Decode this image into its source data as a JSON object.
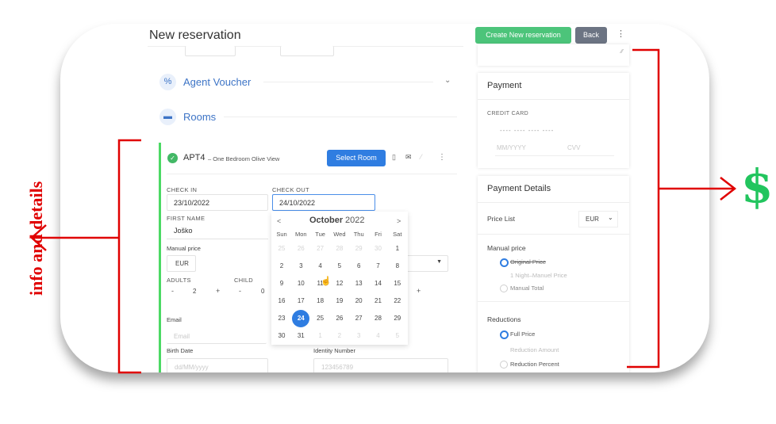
{
  "header": {
    "title": "New reservation",
    "create_button": "Create New reservation",
    "back_button": "Back",
    "more_icon": "kebab-icon"
  },
  "sections": {
    "agent_voucher": "Agent Voucher",
    "rooms": "Rooms"
  },
  "room": {
    "name": "APT4",
    "description": "– One Bedroom Olive View",
    "select_button": "Select Room"
  },
  "form": {
    "check_in_label": "CHECK IN",
    "check_in_value": "23/10/2022",
    "check_out_label": "CHECK OUT",
    "check_out_value": "24/10/2022",
    "first_name_label": "FIRST NAME",
    "first_name_value": "Joško",
    "manual_price_label": "Manual price",
    "currency_value": "EUR",
    "adults_label": "ADULTS",
    "adults_value": "2",
    "child_label": "CHILD",
    "child_value": "0",
    "minus": "-",
    "plus": "+",
    "email_label": "Email",
    "email_placeholder": "Email",
    "birth_date_label": "Birth Date",
    "birth_date_placeholder": "dd/MM/yyyy",
    "identity_label": "Identity Number",
    "identity_placeholder": "123456789"
  },
  "calendar": {
    "month": "October",
    "year": "2022",
    "prev": "<",
    "next": ">",
    "weekdays": [
      "Sun",
      "Mon",
      "Tue",
      "Wed",
      "Thu",
      "Fri",
      "Sat"
    ],
    "rows": [
      [
        "25",
        "26",
        "27",
        "28",
        "29",
        "30",
        "1"
      ],
      [
        "2",
        "3",
        "4",
        "5",
        "6",
        "7",
        "8"
      ],
      [
        "9",
        "10",
        "11",
        "12",
        "13",
        "14",
        "15"
      ],
      [
        "16",
        "17",
        "18",
        "19",
        "20",
        "21",
        "22"
      ],
      [
        "23",
        "24",
        "25",
        "26",
        "27",
        "28",
        "29"
      ],
      [
        "30",
        "31",
        "1",
        "2",
        "3",
        "4",
        "5"
      ]
    ],
    "selected": "24"
  },
  "payment": {
    "title": "Payment",
    "credit_card_label": "CREDIT CARD",
    "card_placeholder": "---- ---- ---- ----",
    "expiry_placeholder": "MM/YYYY",
    "cvv_placeholder": "CVV"
  },
  "payment_details": {
    "title": "Payment Details",
    "price_list_label": "Price List",
    "price_list_value": "EUR",
    "manual_price_label": "Manual price",
    "original_price": "Original Price",
    "one_night": "1 Night–Manuel Price",
    "manual_total": "Manual Total",
    "reductions_label": "Reductions",
    "full_price": "Full Price",
    "reduction_amount": "Reduction Amount",
    "reduction_percent": "Reduction Percent"
  },
  "annotations": {
    "left_text": "info and details",
    "right_symbol": "$",
    "color_red": "#e00000",
    "color_green": "#22c55e"
  }
}
